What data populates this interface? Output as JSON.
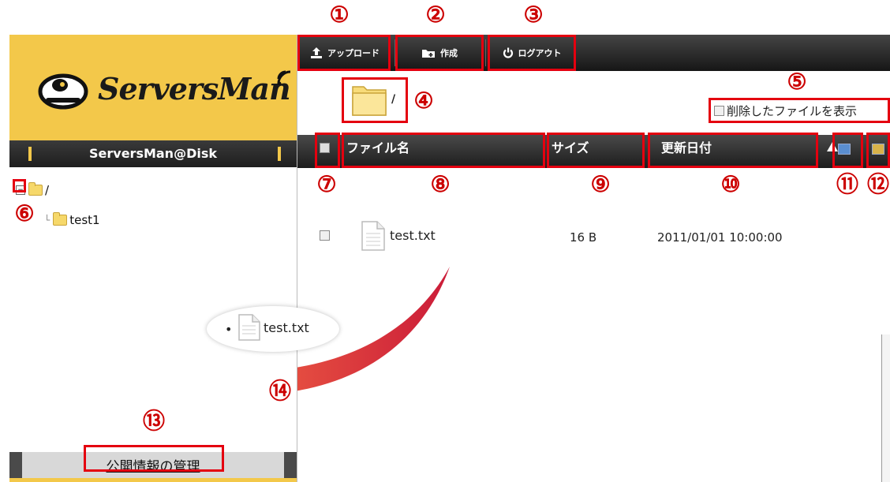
{
  "annotations": {
    "n1": "①",
    "n2": "②",
    "n3": "③",
    "n4": "④",
    "n5": "⑤",
    "n6": "⑥",
    "n7": "⑦",
    "n8": "⑧",
    "n9": "⑨",
    "n10": "⑩",
    "n11": "⑪",
    "n12": "⑫",
    "n13": "⑬",
    "n14": "⑭"
  },
  "sidebar": {
    "logo_text": "ServersMan",
    "disk_label": "ServersMan@Disk",
    "tree": {
      "root_toggle": "−",
      "root_label": "/",
      "child_label": "test1"
    },
    "manage_link": "公開情報の管理"
  },
  "toolbar": {
    "upload_label": "アップロード",
    "create_label": "作成",
    "logout_label": "ログアウト"
  },
  "breadcrumb": {
    "path": "/"
  },
  "show_deleted_label": "削除したファイルを表示",
  "table": {
    "col_name": "ファイル名",
    "col_size": "サイズ",
    "col_date": "更新日付",
    "rows": [
      {
        "name": "test.txt",
        "size": "16 B",
        "date": "2011/01/01 10:00:00"
      }
    ]
  },
  "drag": {
    "bullet": "•",
    "file": "test.txt"
  },
  "colors": {
    "brand_yellow": "#f3c84a",
    "annotation_red": "#e4000f",
    "toolbar_dark": "#1e1e1e"
  }
}
